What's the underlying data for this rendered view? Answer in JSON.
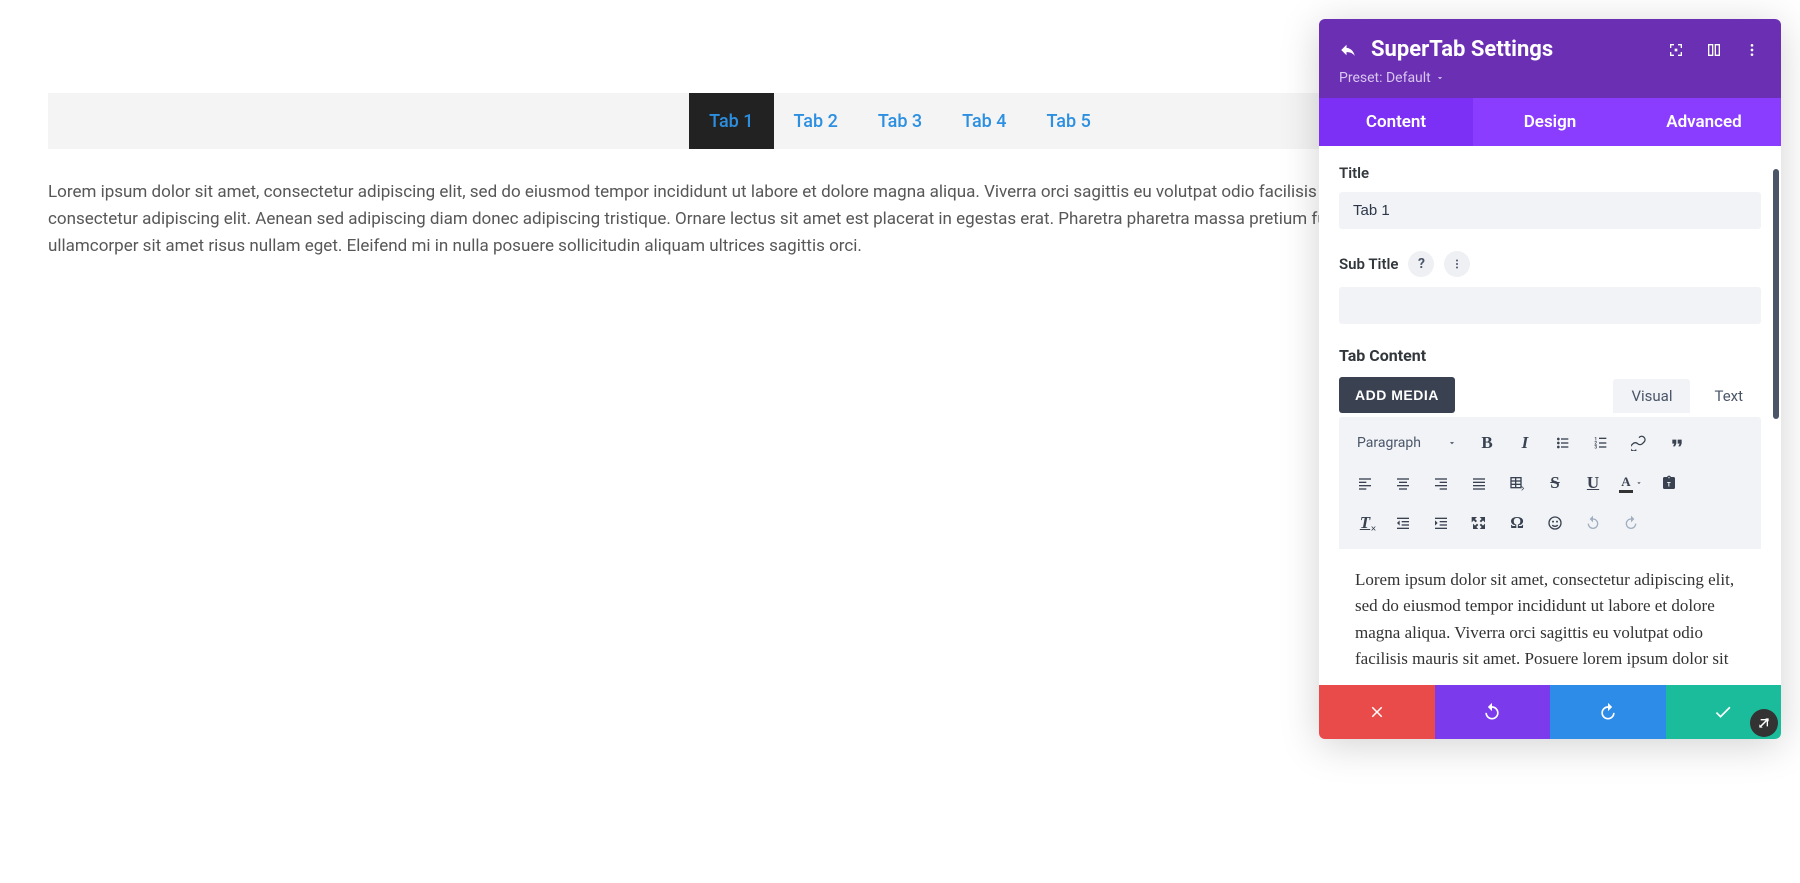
{
  "tabs": [
    "Tab 1",
    "Tab 2",
    "Tab 3",
    "Tab 4",
    "Tab 5"
  ],
  "active_tab_index": 0,
  "content_text": "Lorem ipsum dolor sit amet, consectetur adipiscing elit, sed do eiusmod tempor incididunt ut labore et dolore magna aliqua. Viverra orci sagittis eu volutpat odio facilisis mauris sit amet. Posuere lorem ipsum dolor sit amet consectetur adipiscing elit. Aenean sed adipiscing diam donec adipiscing tristique. Ornare lectus sit amet est placerat in egestas erat. Pharetra pharetra massa pretium fusce id velit ut tortor pretium. Faucibus vitae aliquet nec ullamcorper sit amet risus nullam eget. Eleifend mi in nulla posuere sollicitudin aliquam ultrices sagittis orci.",
  "panel": {
    "title": "SuperTab Settings",
    "preset_label": "Preset: Default",
    "tabs": [
      "Content",
      "Design",
      "Advanced"
    ],
    "active_tab_index": 0,
    "fields": {
      "title_label": "Title",
      "title_value": "Tab 1",
      "subtitle_label": "Sub Title",
      "subtitle_value": ""
    },
    "content_section_label": "Tab Content",
    "add_media_label": "ADD MEDIA",
    "editor_modes": {
      "visual": "Visual",
      "text": "Text"
    },
    "format_label": "Paragraph",
    "editor_content": "Lorem ipsum dolor sit amet, consectetur adipiscing elit, sed do eiusmod tempor incididunt ut labore et dolore magna aliqua. Viverra orci sagittis eu volutpat odio facilisis mauris sit amet. Posuere lorem ipsum dolor sit"
  }
}
